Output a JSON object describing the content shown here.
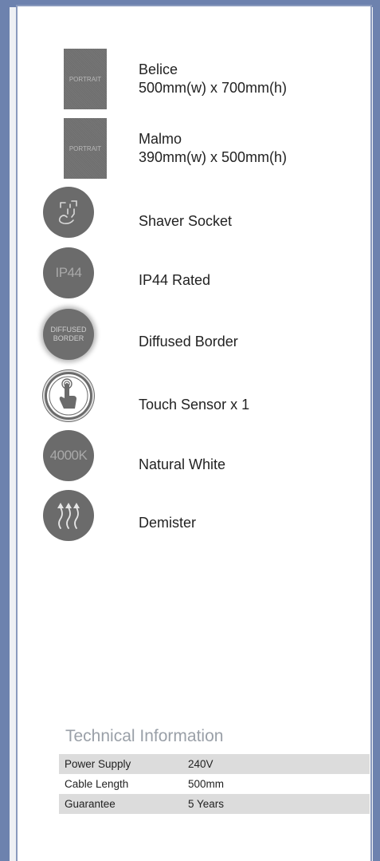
{
  "features": [
    {
      "icon": "portrait-icon",
      "icon_text": "PORTRAIT",
      "lines": [
        "Belice",
        "500mm(w) x 700mm(h)"
      ]
    },
    {
      "icon": "portrait-icon",
      "icon_text": "PORTRAIT",
      "lines": [
        "Malmo",
        "390mm(w) x 500mm(h)"
      ]
    },
    {
      "icon": "shaver-socket-icon",
      "label": "Shaver Socket"
    },
    {
      "icon": "ip44-icon",
      "icon_text": "IP44",
      "label": "IP44 Rated"
    },
    {
      "icon": "diffused-border-icon",
      "icon_text_lines": [
        "DIFFUSED",
        "BORDER"
      ],
      "label": "Diffused Border"
    },
    {
      "icon": "touch-sensor-icon",
      "label": "Touch Sensor x 1"
    },
    {
      "icon": "4000k-icon",
      "icon_text": "4000K",
      "label": "Natural White"
    },
    {
      "icon": "demister-icon",
      "label": "Demister"
    }
  ],
  "tech": {
    "title": "Technical Information",
    "rows": [
      {
        "key": "Power Supply",
        "value": "240V"
      },
      {
        "key": "Cable Length",
        "value": "500mm"
      },
      {
        "key": "Guarantee",
        "value": "5 Years"
      }
    ]
  }
}
